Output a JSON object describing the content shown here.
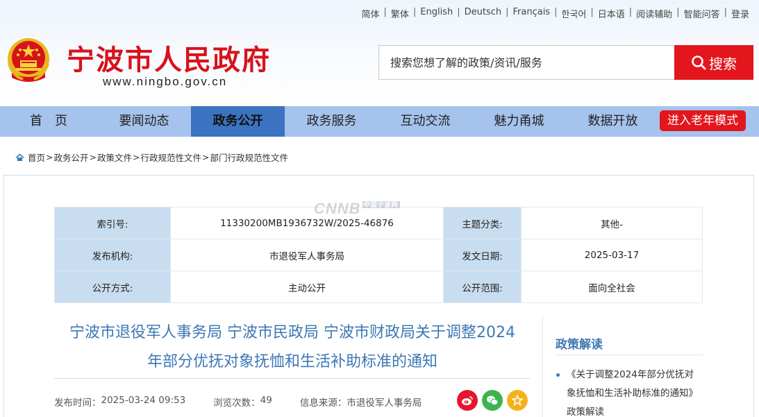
{
  "toplinks": [
    "简体",
    "繁体",
    "English",
    "Deutsch",
    "Français",
    "한국어",
    "日本语",
    "阅读辅助",
    "智能问答",
    "登录"
  ],
  "site": {
    "title": "宁波市人民政府",
    "url": "www.ningbo.gov.cn"
  },
  "search": {
    "placeholder": "搜索您想了解的政策/资讯/服务",
    "button_label": "搜索"
  },
  "nav": {
    "items": [
      "首　页",
      "要闻动态",
      "政务公开",
      "政务服务",
      "互动交流",
      "魅力甬城",
      "数据开放"
    ],
    "active_index": 2,
    "elder_mode": "进入老年模式"
  },
  "breadcrumb": [
    "首页",
    "政务公开",
    "政策文件",
    "行政规范性文件",
    "部门行政规范性文件"
  ],
  "meta": {
    "rows": [
      {
        "l1": "索引号:",
        "v1": "11330200MB1936732W/2025-46876",
        "l2": "主题分类:",
        "v2": "其他-"
      },
      {
        "l1": "发布机构:",
        "v1": "市退役军人事务局",
        "l2": "发文日期:",
        "v2": "2025-03-17"
      },
      {
        "l1": "公开方式:",
        "v1": "主动公开",
        "l2": "公开范围:",
        "v2": "面向全社会"
      }
    ]
  },
  "watermark": {
    "text": "CNNB",
    "tag": "中国宁波网"
  },
  "document": {
    "title_line1": "宁波市退役军人事务局 宁波市民政局 宁波市财政局关于调整2024",
    "title_line2": "年部分优抚对象抚恤和生活补助标准的通知",
    "publish_label": "发布时间：",
    "publish_time": "2025-03-24 09:53",
    "views_label": "浏览次数：",
    "views": "49",
    "source_label": "信息来源：",
    "source": "市退役军人事务局"
  },
  "sidebar": {
    "title": "政策解读",
    "links": [
      "《关于调整2024年部分优抚对象抚恤和生活补助标准的通知》政策解读"
    ]
  },
  "colors": {
    "brand_red": "#e3161d",
    "nav_bg": "#a5c3ec",
    "nav_active": "#3b73c0",
    "title_blue": "#3d78b5",
    "label_bg": "#c9ddf0"
  }
}
